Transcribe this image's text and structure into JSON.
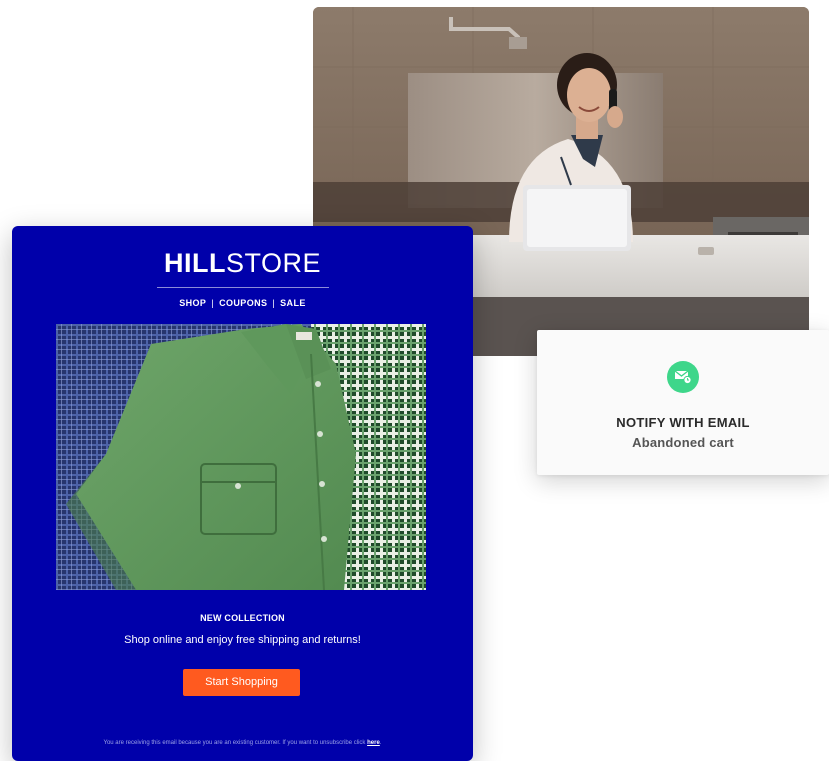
{
  "photo": {
    "subject": "woman-on-phone-with-laptop"
  },
  "notify_card": {
    "icon": "mail-clock-icon",
    "title": "NOTIFY WITH EMAIL",
    "subtitle": "Abandoned cart",
    "badge_color": "#3ed68a"
  },
  "email": {
    "background_color": "#0000aa",
    "brand": {
      "bold": "HILL",
      "light": "STORE"
    },
    "nav": {
      "shop": "SHOP",
      "separator": "|",
      "coupons": "COUPONS",
      "sale": "SALE"
    },
    "hero": {
      "subject": "folded-shirts"
    },
    "headline": "NEW COLLECTION",
    "body": "Shop online and enjoy free shipping and returns!",
    "cta_label": "Start Shopping",
    "cta_color": "#ff5a1f",
    "footer_text": "You are receiving this email because you are an existing customer. If you want to unsubscribe click",
    "footer_link": "here",
    "footer_end": "."
  }
}
